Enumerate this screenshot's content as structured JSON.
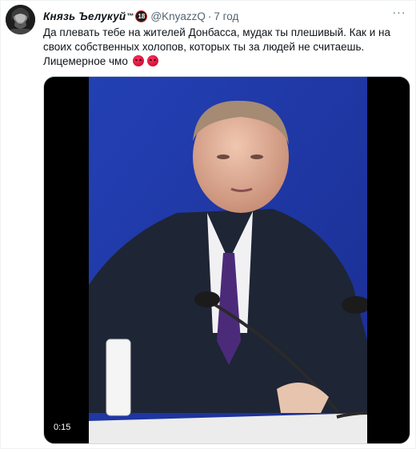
{
  "tweet": {
    "author": {
      "display_name": "Князь Ъелукуй",
      "trademark": "™",
      "age_badge": "18",
      "handle": "@KnyazzQ",
      "separator": "·",
      "time": "7 год"
    },
    "text_line1": "Да плевать тебе на жителей Донбасса, мудак ты плешивый. Как и на",
    "text_line2": "своих собственных холопов, которых ты за людей не считаешь.",
    "text_line3": "Лицемерное чмо",
    "emojis": [
      "angry-face-emoji",
      "angry-face-emoji"
    ],
    "more_icon": "more-horizontal-icon",
    "more_glyph": "···",
    "media": {
      "type": "video",
      "duration": "0:15"
    }
  },
  "colors": {
    "text": "#0f1419",
    "secondary": "#536471",
    "border": "#cfd9de",
    "video_backdrop": "#2038a8"
  }
}
